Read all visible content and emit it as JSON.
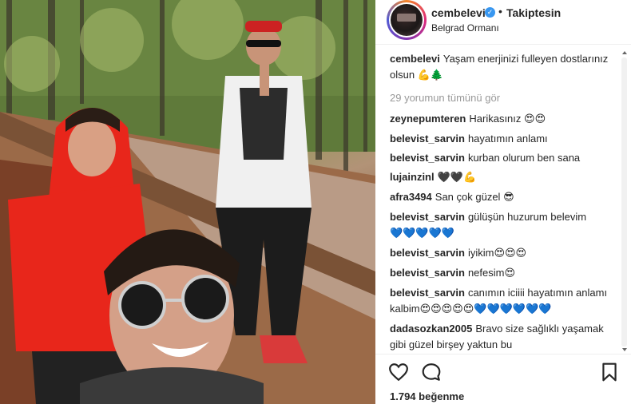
{
  "photo": {
    "description_icon": "selfie-photo"
  },
  "header": {
    "username": "cembelevi",
    "separator": "•",
    "follow_status": "Takiptesin",
    "location": "Belgrad Ormanı",
    "verified_icon": "verified-badge-icon"
  },
  "caption": {
    "username": "cembelevi",
    "text": "Yaşam enerjinizi fulleyen dostlarınız olsun",
    "emojis": "💪🌲"
  },
  "view_all_comments": "29 yorumun tümünü gör",
  "comments": [
    {
      "username": "zeynepumteren",
      "text": "Harikasınız",
      "emojis": "😍😍"
    },
    {
      "username": "belevist_sarvin",
      "text": "hayatımın anlamı",
      "emojis": ""
    },
    {
      "username": "belevist_sarvin",
      "text": "kurban olurum ben sana",
      "emojis": ""
    },
    {
      "username": "lujainzinl",
      "text": "",
      "emojis": "🖤🖤💪"
    },
    {
      "username": "afra3494",
      "text": "San çok güzel",
      "emojis": "😎"
    },
    {
      "username": "belevist_sarvin",
      "text": "gülüşün huzurum belevim",
      "emojis": "💙💙💙💙💙"
    },
    {
      "username": "belevist_sarvin",
      "text": "iyikim",
      "emojis": "😍😍😍"
    },
    {
      "username": "belevist_sarvin",
      "text": "nefesim",
      "emojis": "😍"
    },
    {
      "username": "belevist_sarvin",
      "text": "canımın iciiii hayatımın anlamı kalbim",
      "emojis": "😍😍😍😍😍💙💙💙💙💙💙"
    },
    {
      "username": "dadasozkan2005",
      "text": "Bravo size sağlıklı yaşamak gibi güzel birşey yaktun bu",
      "emojis": ""
    }
  ],
  "actions": {
    "like_icon": "heart-icon",
    "comment_icon": "comment-icon",
    "save_icon": "bookmark-icon"
  },
  "likes": "1.794 beğenme",
  "colors": {
    "accent": "#3897f0",
    "text": "#262626",
    "muted": "#999999",
    "border": "#efefef"
  }
}
